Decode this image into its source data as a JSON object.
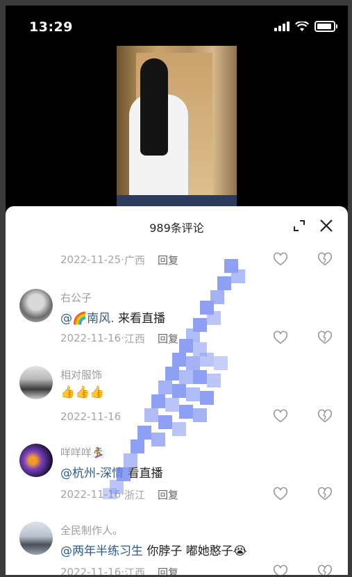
{
  "status_bar": {
    "time": "13:29"
  },
  "comments_panel": {
    "title": "989条评论",
    "reply_label": "回复",
    "first_meta": {
      "date": "2022-11-25",
      "location": "广西"
    },
    "comments": [
      {
        "username": "右公子",
        "mention": "@🌈南风.",
        "text": " 来看直播",
        "date": "2022-11-16",
        "location": "江西"
      },
      {
        "username": "相对服饰",
        "mention": "",
        "text": "👍👍👍",
        "date": "2022-11-16",
        "location": ""
      },
      {
        "username": "咩咩咩🏂",
        "mention": "@杭州-深情",
        "text": " 看直播",
        "date": "2022-11-16",
        "location": "浙江"
      },
      {
        "username": "全民制作人。",
        "mention": "@两年半练习生",
        "text": " 你脖子 嘟她憨子😭",
        "date": "2022-11-16",
        "location": "江西"
      }
    ]
  },
  "colors": {
    "mention": "#2f5b8c",
    "meta": "#a5a5a5",
    "sheet_bg": "#ffffff"
  },
  "icons": [
    "signal-icon",
    "wifi-icon",
    "battery-icon",
    "expand-icon",
    "close-icon",
    "heart-icon",
    "dislike-icon"
  ]
}
